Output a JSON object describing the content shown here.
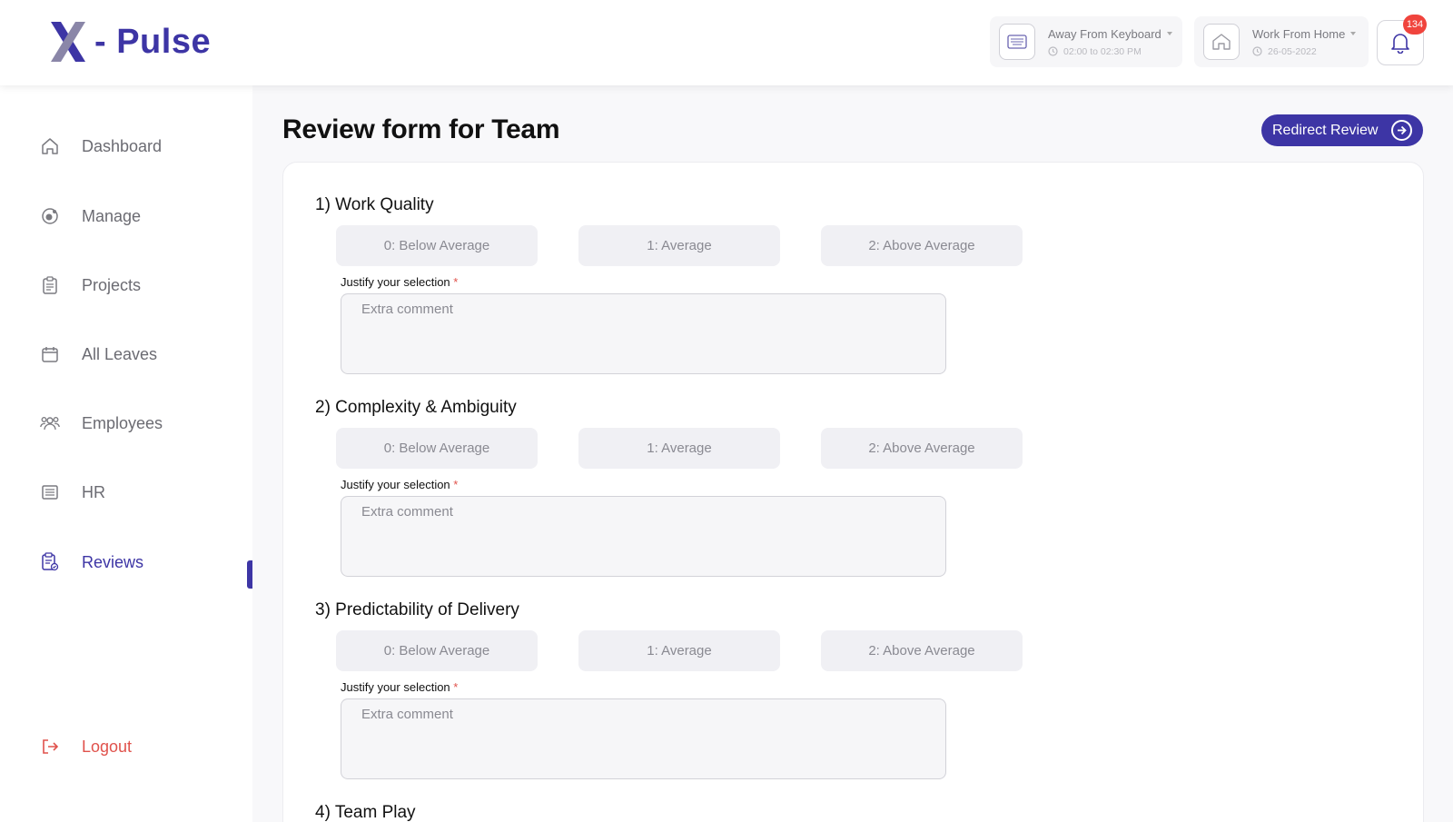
{
  "brand": {
    "name": "- Pulse"
  },
  "header": {
    "status_afk": {
      "title": "Away From Keyboard",
      "sub": "02:00 to 02:30 PM"
    },
    "status_wfh": {
      "title": "Work From Home",
      "sub": "26-05-2022"
    },
    "notifications": {
      "count": "134"
    }
  },
  "sidebar": {
    "items": [
      {
        "label": "Dashboard",
        "icon": "home-icon"
      },
      {
        "label": "Manage",
        "icon": "manage-icon"
      },
      {
        "label": "Projects",
        "icon": "clipboard-icon"
      },
      {
        "label": "All Leaves",
        "icon": "calendar-icon"
      },
      {
        "label": "Employees",
        "icon": "people-icon"
      },
      {
        "label": "HR",
        "icon": "list-icon"
      },
      {
        "label": "Reviews",
        "icon": "review-icon",
        "active": true
      }
    ],
    "logout": "Logout"
  },
  "main": {
    "title": "Review form for Team",
    "redirect_label": "Redirect Review",
    "justify_label": "Justify your selection",
    "required_mark": "*",
    "comment_placeholder": "Extra comment",
    "options": [
      "0:  Below Average",
      "1:  Average",
      "2:  Above Average"
    ],
    "questions": [
      "1) Work Quality",
      "2) Complexity & Ambiguity",
      "3) Predictability of Delivery",
      "4) Team Play"
    ]
  },
  "colors": {
    "accent": "#3d35a5",
    "danger": "#e0524c",
    "badge": "#f0443d"
  }
}
